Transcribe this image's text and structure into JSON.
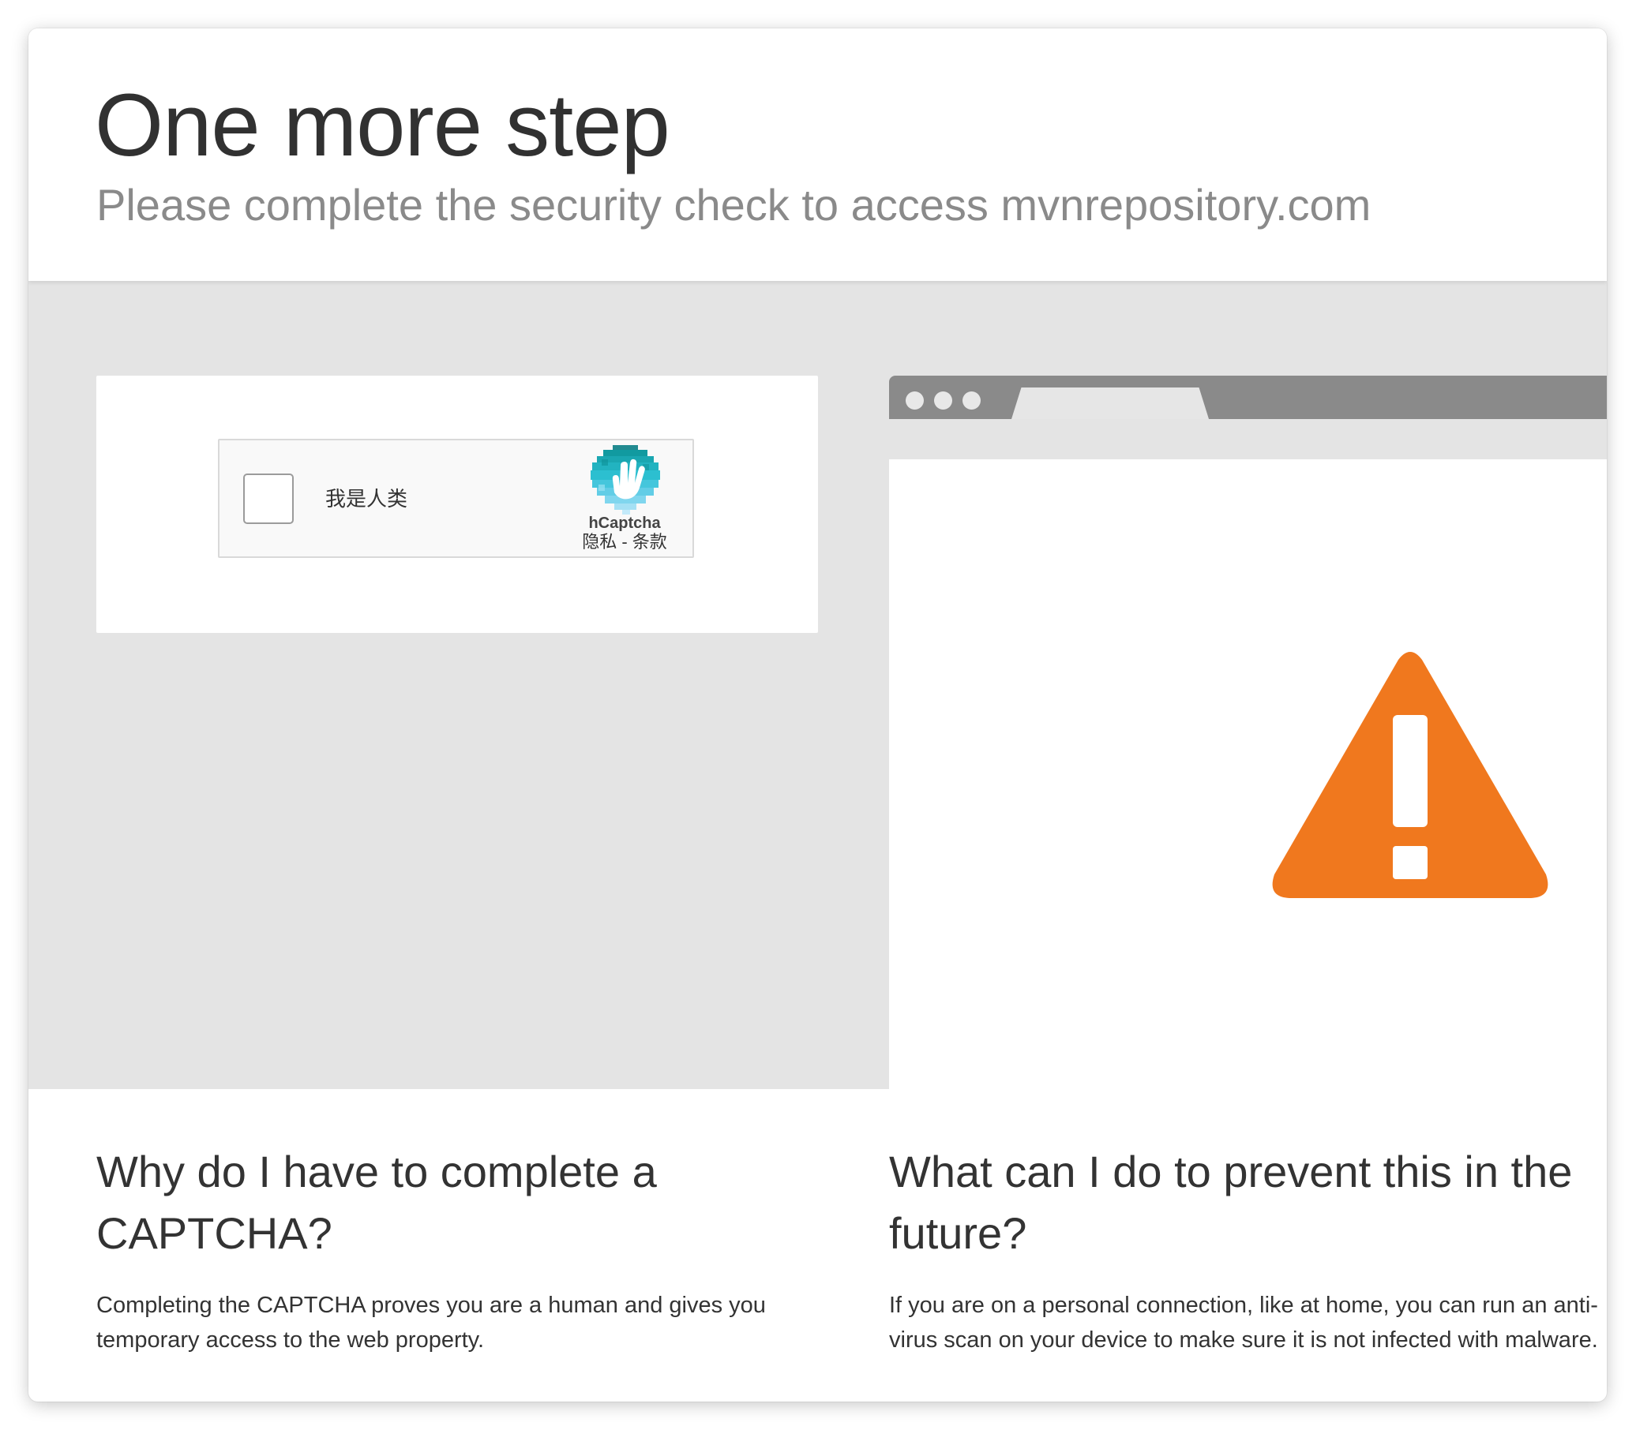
{
  "header": {
    "title": "One more step",
    "subtitle": "Please complete the security check to access mvnrepository.com"
  },
  "captcha": {
    "checkbox_label": "我是人类",
    "brand": "hCaptcha",
    "privacy_link": "隐私",
    "separator": " - ",
    "terms_link": "条款",
    "checked": false,
    "logo_icon": "hcaptcha-hand-logo-icon"
  },
  "illustration": {
    "icon": "warning-triangle-icon",
    "warning_color": "#f0781e",
    "bar_color": "#8a8a8a"
  },
  "info": {
    "left_heading": "Why do I have to complete a CAPTCHA?",
    "left_text": "Completing the CAPTCHA proves you are a human and gives you temporary access to the web property.",
    "right_heading": "What can I do to prevent this in the future?",
    "right_text": "If you are on a personal connection, like at home, you can run an anti-virus scan on your device to make sure it is not infected with malware."
  }
}
